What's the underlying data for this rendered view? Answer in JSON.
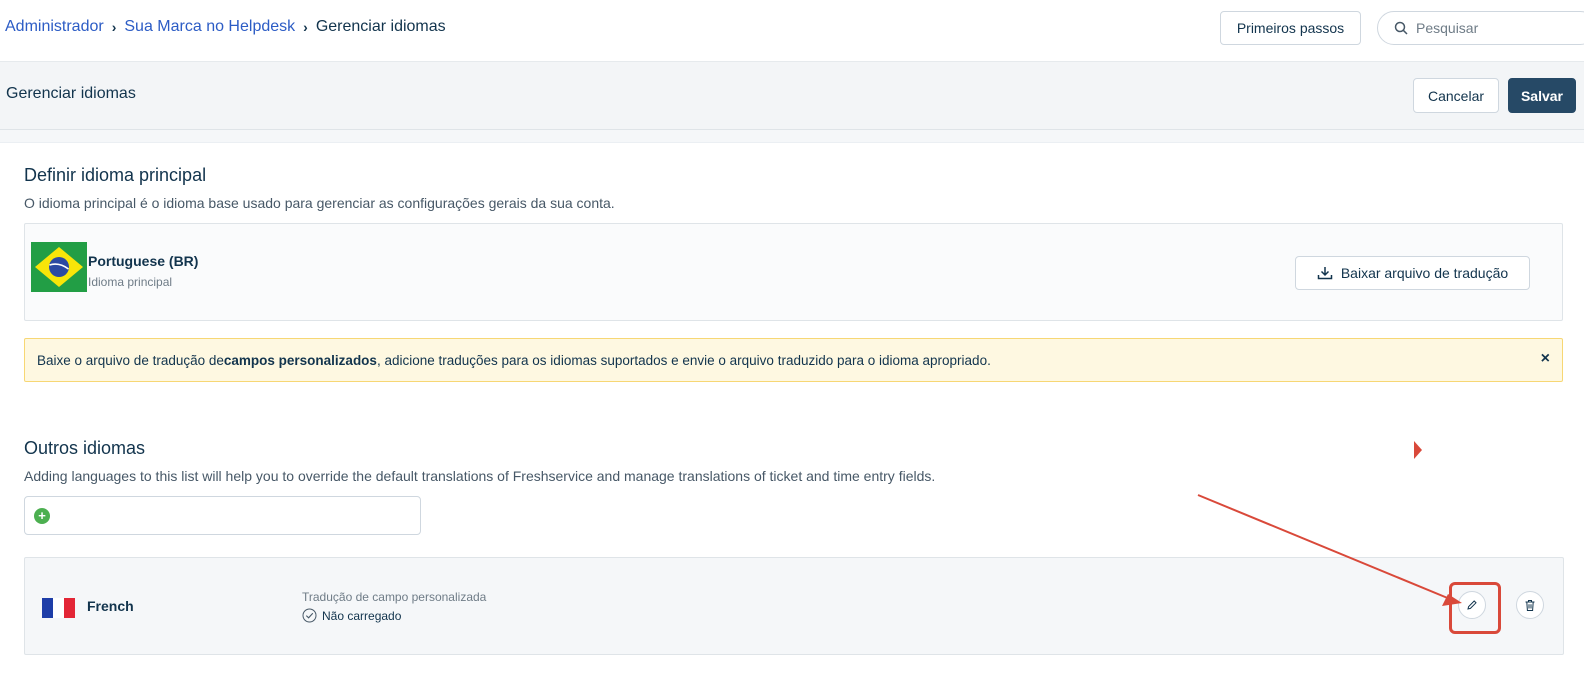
{
  "breadcrumb": {
    "items": [
      "Administrador",
      "Sua Marca no Helpdesk",
      "Gerenciar idiomas"
    ]
  },
  "header": {
    "first_steps_label": "Primeiros passos",
    "search_placeholder": "Pesquisar"
  },
  "subheader": {
    "title": "Gerenciar idiomas",
    "cancel_label": "Cancelar",
    "save_label": "Salvar"
  },
  "primary_section": {
    "title": "Definir idioma principal",
    "description": "O idioma principal é o idioma base usado para gerenciar as configurações gerais da sua conta.",
    "language_name": "Portuguese (BR)",
    "language_sub": "Idioma principal",
    "download_label": "Baixar arquivo de tradução"
  },
  "alert": {
    "text_before": "Baixe o arquivo de tradução de ",
    "text_bold": "campos personalizados",
    "text_after": ", adicione traduções para os idiomas suportados e envie o arquivo traduzido para o idioma apropriado.",
    "close_label": "×"
  },
  "other_section": {
    "title": "Outros idiomas",
    "description": "Adding languages to this list will help you to override the default translations of Freshservice and manage translations of ticket and time entry fields."
  },
  "languages": [
    {
      "name": "French",
      "detail_label": "Tradução de campo personalizada",
      "status": "Não carregado"
    }
  ],
  "colors": {
    "brand_blue": "#2c5cc5",
    "save_bg": "#264966",
    "alert_bg": "#fef8e1",
    "annotation_red": "#d9493a"
  }
}
